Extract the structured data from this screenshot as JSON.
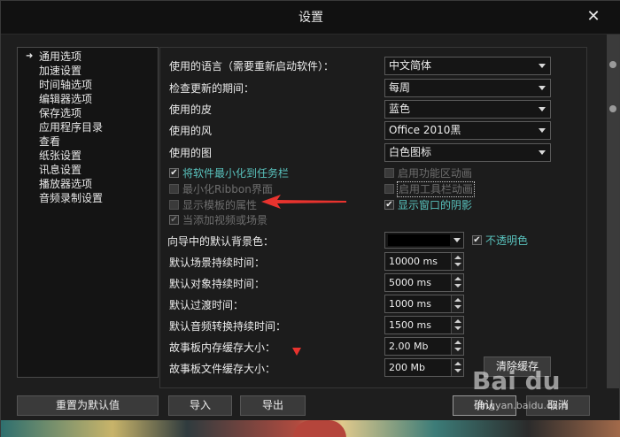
{
  "window": {
    "title": "设置"
  },
  "sidebar": {
    "items": [
      {
        "label": "通用选项",
        "selected": true
      },
      {
        "label": "加速设置"
      },
      {
        "label": "时间轴选项"
      },
      {
        "label": "编辑器选项"
      },
      {
        "label": "保存选项"
      },
      {
        "label": "应用程序目录"
      },
      {
        "label": "查看"
      },
      {
        "label": "纸张设置"
      },
      {
        "label": "讯息设置"
      },
      {
        "label": "播放器选项"
      },
      {
        "label": "音频录制设置"
      }
    ]
  },
  "general": {
    "language": {
      "label": "使用的语言（需要重新启动软件）：",
      "value": "中文简体"
    },
    "update_period": {
      "label": "检查更新的期间：",
      "value": "每周"
    },
    "skin": {
      "label": "使用的皮",
      "value": "蓝色"
    },
    "style": {
      "label": "使用的风",
      "value": "Office 2010黑"
    },
    "icons": {
      "label": "使用的图",
      "value": "白色图标"
    },
    "checkboxes": [
      {
        "label": "将软件最小化到任务栏",
        "checked": true,
        "enabled": true
      },
      {
        "label": "最小化Ribbon界面",
        "checked": false,
        "enabled": false
      },
      {
        "label": "显示模板的属性",
        "checked": false,
        "enabled": false
      },
      {
        "label": "当添加视频或场景",
        "checked": true,
        "enabled": false
      },
      {
        "label": "启用功能区动画",
        "checked": false,
        "enabled": false
      },
      {
        "label": "启用工具栏动画",
        "checked": false,
        "enabled": false
      },
      {
        "label": "显示窗口的阴影",
        "checked": true,
        "enabled": true
      }
    ],
    "bg_color": {
      "label": "向导中的默认背景色：",
      "value_color": "#000000"
    },
    "opaque": {
      "label": "不透明色",
      "checked": true
    },
    "scene_duration": {
      "label": "默认场景持续时间：",
      "value": "10000 ms"
    },
    "object_duration": {
      "label": "默认对象持续时间：",
      "value": "5000 ms"
    },
    "transition_duration": {
      "label": "默认过渡时间：",
      "value": "1000 ms"
    },
    "audio_transition_duration": {
      "label": "默认音频转换持续时间：",
      "value": "1500 ms"
    },
    "storyboard_mem_cache": {
      "label": "故事板内存缓存大小：",
      "value": "2.00 Mb"
    },
    "storyboard_file_cache": {
      "label": "故事板文件缓存大小：",
      "value": "200 Mb"
    },
    "clear_cache": "清除缓存"
  },
  "footer": {
    "reset": "重置为默认值",
    "import": "导入",
    "export": "导出",
    "ok": "确认",
    "cancel": "取消"
  },
  "watermark": {
    "logo": "Bai du",
    "sub": "jingyan.baidu.com"
  },
  "colors": {
    "accent_teal": "#59c2bd",
    "annotation_red": "#e8332e"
  }
}
